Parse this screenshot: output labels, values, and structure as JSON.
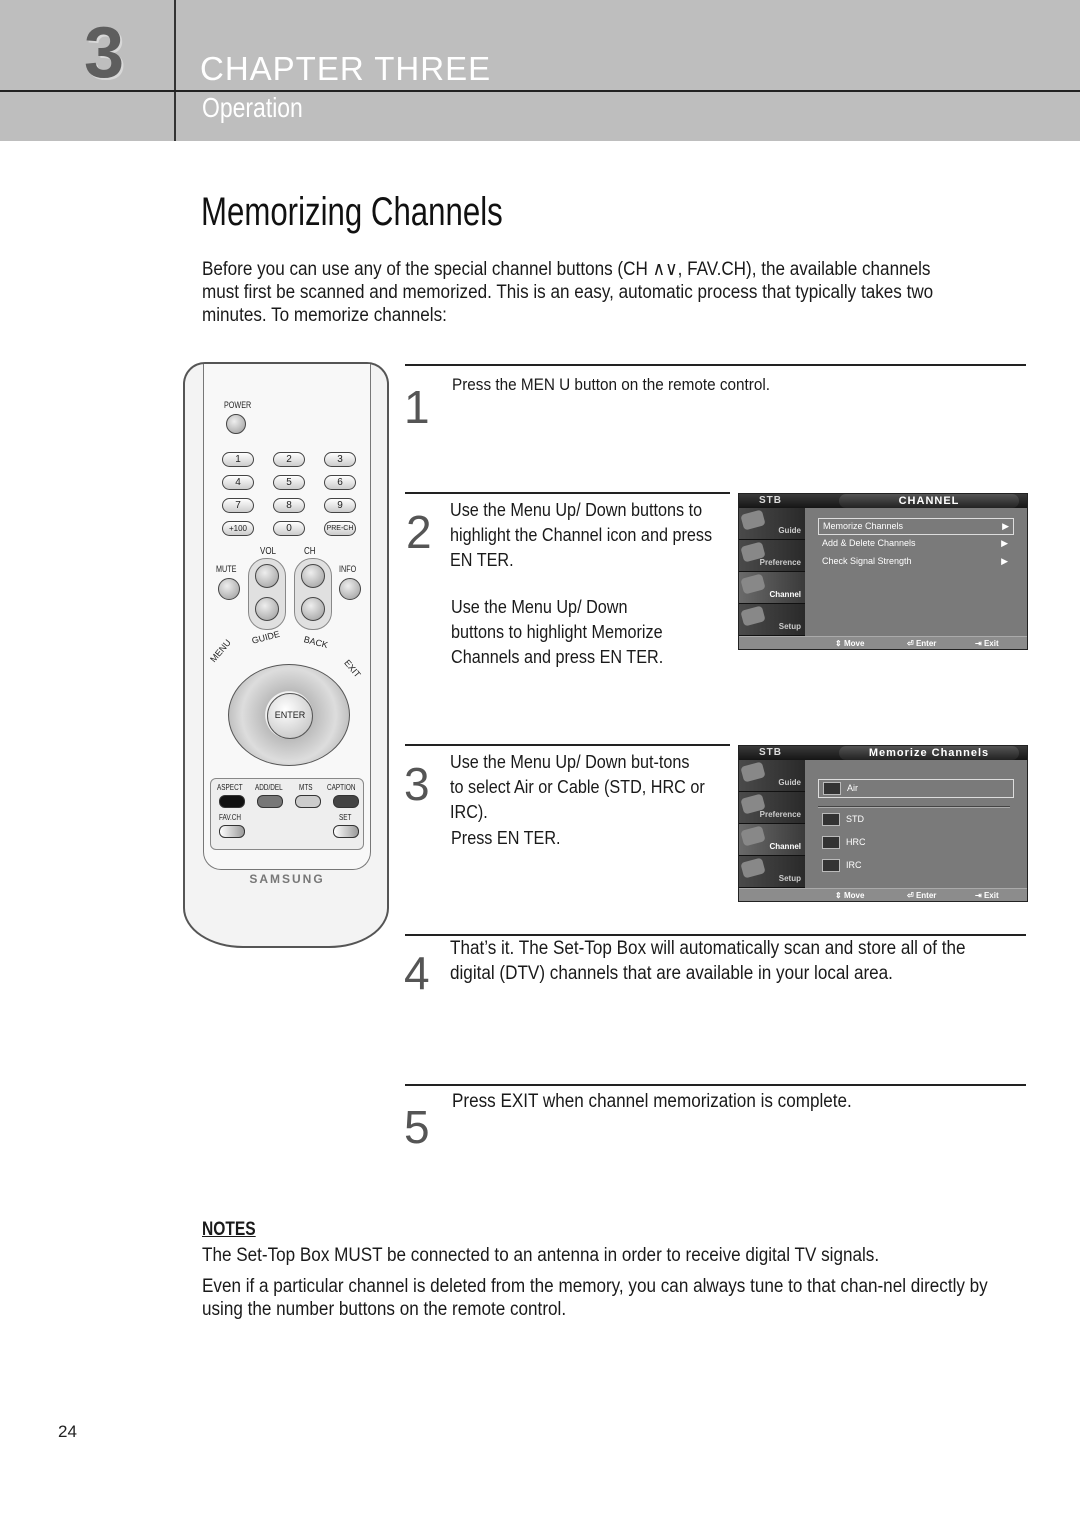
{
  "header": {
    "chapter_number": "3",
    "chapter_title": "CHAPTER THREE",
    "section": "Operation",
    "band_color": "#bebebe"
  },
  "page": {
    "title": "Memorizing Channels",
    "intro": "Before you can use any of the special channel buttons (CH ∧∨, FAV.CH), the available channels must first be scanned and memorized. This is an easy, automatic process that typically takes two minutes. To memorize channels:",
    "page_number": "24"
  },
  "remote": {
    "power_label": "POWER",
    "number_keys": [
      "1",
      "2",
      "3",
      "4",
      "5",
      "6",
      "7",
      "8",
      "9",
      "+100",
      "0",
      "PRE-CH"
    ],
    "vol_label": "VOL",
    "ch_label": "CH",
    "mute_label": "MUTE",
    "info_label": "INFO",
    "guide_label": "GUIDE",
    "back_label": "BACK",
    "menu_label": "MENU",
    "exit_label": "EXIT",
    "enter_label": "ENTER",
    "aspect_label": "ASPECT",
    "adddel_label": "ADD/DEL",
    "mts_label": "MTS",
    "caption_label": "CAPTION",
    "favch_label": "FAV.CH",
    "set_label": "SET",
    "brand": "SAMSUNG"
  },
  "steps": [
    {
      "number": "1",
      "text": "Press the MEN U button on the remote control."
    },
    {
      "number": "2",
      "text": "Use the Menu Up/ Down buttons to highlight the Channel icon and press EN TER.",
      "text2": "Use the Menu Up/ Down buttons to highlight Memorize Channels and press EN TER."
    },
    {
      "number": "3",
      "text": "Use the Menu Up/ Down but-tons to select Air or Cable (STD, HRC or IRC).",
      "text2": "Press EN TER."
    },
    {
      "number": "4",
      "text": "That’s it. The Set-Top Box will automatically scan and store all of  the digital (DTV) channels that are available in your local area."
    },
    {
      "number": "5",
      "text": "Press EXIT when channel memorization is complete."
    }
  ],
  "osd_common": {
    "stb": "STB",
    "side_items": [
      "Guide",
      "Preference",
      "Channel",
      "Setup"
    ],
    "active_side": "Channel",
    "move": "Move",
    "enter": "Enter",
    "exit": "Exit"
  },
  "osd1": {
    "title": "CHANNEL",
    "items": [
      "Memorize Channels",
      "Add & Delete Channels",
      "Check Signal Strength"
    ],
    "selected": "Memorize Channels"
  },
  "osd2": {
    "title": "Memorize Channels",
    "air": "Air",
    "cable_options": [
      "STD",
      "HRC",
      "IRC"
    ]
  },
  "notes": {
    "heading": "NOTES",
    "items": [
      "The Set-Top Box MUST be connected to an antenna in order to receive digital TV signals.",
      "Even if a particular channel is deleted from the memory, you can always tune to that chan-nel directly by using the number buttons on the remote control."
    ]
  }
}
